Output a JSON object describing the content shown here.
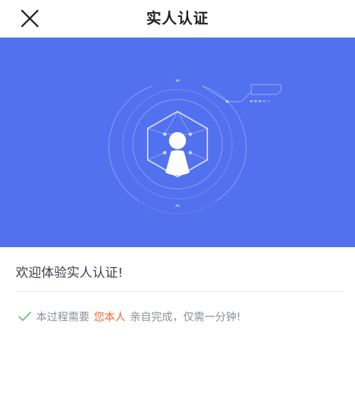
{
  "header": {
    "title": "实人认证"
  },
  "main": {
    "welcome_text": "欢迎体验实人认证!",
    "notice": {
      "before": "本过程需要",
      "highlight": "您本人",
      "after": "亲自完成，仅需一分钟!"
    }
  },
  "icons": {
    "close": "close-icon",
    "check": "check-icon",
    "face_id": "face-id-shield-icon"
  },
  "colors": {
    "hero_background": "#5271ef",
    "highlight": "#ed6a2c",
    "check": "#65c080"
  }
}
